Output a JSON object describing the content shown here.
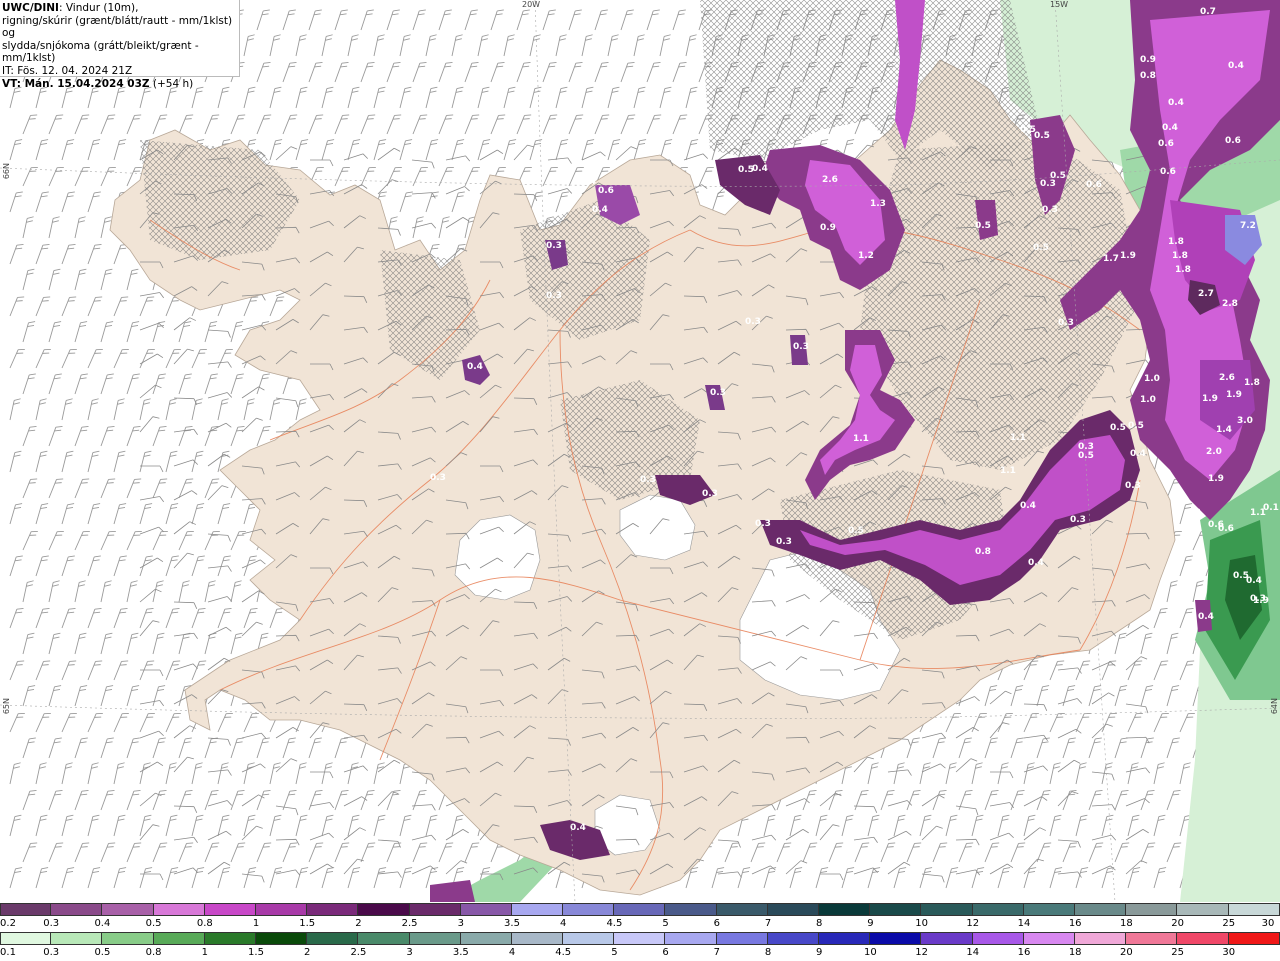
{
  "header": {
    "model": "UWC/DINI",
    "line1_rest": ": Vindur (10m),",
    "line2": "rigning/skúrir (grænt/blátt/rautt - mm/1klst) og",
    "line3": "slydda/snjókoma (grátt/bleikt/grænt - mm/1klst)",
    "line4": "IT: Fös. 12. 04. 2024 21Z",
    "line5_bold": "VT: Mán. 15.04.2024 03Z",
    "line5_rest": " (+54 h)"
  },
  "graticule_labels": {
    "lon_20w": "20W",
    "lon_15w": "15W",
    "lat_66n": "66N",
    "lat_65n": "65N",
    "lat_64n": "64N"
  },
  "map": {
    "region": "Iceland",
    "colors": {
      "sea": "#ffffff",
      "land": "#f1e4d6",
      "roads": "#e8835a",
      "barb": "#9a9a9a",
      "mix_purple_dark": "#5e2a5e",
      "mix_purple": "#8b3a8b",
      "mix_magenta": "#c050c8",
      "mix_pink": "#e070e0",
      "rain_green": "#3a9a50",
      "rain_green_light": "#9fd9a8",
      "rain_green_pale": "#d6f0d6",
      "blue_spot": "#8a8ae0"
    },
    "value_labels": [
      {
        "text": "0.7"
      },
      {
        "text": "0.4"
      },
      {
        "text": "0.9"
      },
      {
        "text": "0.8"
      },
      {
        "text": "0.4"
      },
      {
        "text": "0.4"
      },
      {
        "text": "0.5"
      },
      {
        "text": "0.6"
      },
      {
        "text": "0.6"
      },
      {
        "text": "0.6"
      },
      {
        "text": "7.2"
      },
      {
        "text": "1.8"
      },
      {
        "text": "1.8"
      },
      {
        "text": "1.8"
      },
      {
        "text": "2.7"
      },
      {
        "text": "2.8"
      },
      {
        "text": "1.7"
      },
      {
        "text": "1.9"
      },
      {
        "text": "2.6"
      },
      {
        "text": "1.9"
      },
      {
        "text": "1.9"
      },
      {
        "text": "1.8"
      },
      {
        "text": "3.0"
      },
      {
        "text": "1.4"
      },
      {
        "text": "2.0"
      },
      {
        "text": "1.9"
      },
      {
        "text": "1.0"
      },
      {
        "text": "1.0"
      },
      {
        "text": "0.5"
      },
      {
        "text": "0.5"
      },
      {
        "text": "1.9"
      },
      {
        "text": "0.6"
      },
      {
        "text": "2.6"
      },
      {
        "text": "1.3"
      },
      {
        "text": "0.9"
      },
      {
        "text": "1.2"
      },
      {
        "text": "0.5"
      },
      {
        "text": "0.4"
      },
      {
        "text": "0.3"
      },
      {
        "text": "0.5"
      },
      {
        "text": "0.3"
      },
      {
        "text": "0.5"
      },
      {
        "text": "0.5"
      },
      {
        "text": "0.3"
      },
      {
        "text": "0.6"
      },
      {
        "text": "0.4"
      },
      {
        "text": "1.1"
      },
      {
        "text": "1.1"
      },
      {
        "text": "1.1"
      },
      {
        "text": "0.3"
      },
      {
        "text": "0.3"
      },
      {
        "text": "0.3"
      },
      {
        "text": "0.5"
      },
      {
        "text": "0.8"
      },
      {
        "text": "0.4"
      },
      {
        "text": "0.3"
      },
      {
        "text": "0.5"
      },
      {
        "text": "0.3"
      },
      {
        "text": "0.3"
      },
      {
        "text": "0.3"
      },
      {
        "text": "0.4"
      },
      {
        "text": "0.4"
      },
      {
        "text": "0.4"
      },
      {
        "text": "0.3"
      },
      {
        "text": "0.4"
      },
      {
        "text": "0.6"
      },
      {
        "text": "0.4"
      },
      {
        "text": "0.3"
      },
      {
        "text": "0.4"
      },
      {
        "text": "0.3"
      },
      {
        "text": "0.3"
      },
      {
        "text": "0.3"
      },
      {
        "text": "0.3"
      },
      {
        "text": "0.3"
      },
      {
        "text": "0.5"
      },
      {
        "text": "1.1"
      },
      {
        "text": "0.4"
      },
      {
        "text": "0.3"
      },
      {
        "text": "0.6"
      },
      {
        "text": "0.1"
      },
      {
        "text": "0.5"
      },
      {
        "text": "0.3"
      }
    ]
  },
  "colorbar_snow": {
    "labels": [
      "0.2",
      "0.3",
      "0.4",
      "0.5",
      "0.8",
      "1",
      "1.5",
      "2",
      "2.5",
      "3",
      "3.5",
      "4",
      "4.5",
      "5",
      "6",
      "7",
      "8",
      "9",
      "10",
      "12",
      "14",
      "16",
      "18",
      "20",
      "25",
      "30"
    ],
    "colors": [
      "#6a3a6a",
      "#8a4a8a",
      "#a860a8",
      "#d878d8",
      "#c848c8",
      "#a83aa8",
      "#7a2a7a",
      "#4a0a4a",
      "#6a2a6a",
      "#8858a8",
      "#a8a8f0",
      "#8888d8",
      "#6868b8",
      "#4a5a8a",
      "#3a5a6a",
      "#2a4a5a",
      "#0a3a3a",
      "#1a4a4a",
      "#2a5a5a",
      "#3a6a6a",
      "#4a7a7a",
      "#6a8a8a",
      "#8a9a9a",
      "#a8b8b8",
      "#c8d8d8"
    ]
  },
  "colorbar_rain": {
    "labels": [
      "0.1",
      "0.3",
      "0.5",
      "0.8",
      "1",
      "1.5",
      "2",
      "2.5",
      "3",
      "3.5",
      "4",
      "4.5",
      "5",
      "6",
      "7",
      "8",
      "9",
      "10",
      "12",
      "14",
      "16",
      "18",
      "20",
      "25",
      "30"
    ],
    "colors": [
      "#e0f8e0",
      "#b8e8b8",
      "#88cc88",
      "#58aa58",
      "#2a7a2a",
      "#0a4a0a",
      "#2a6a4a",
      "#4a8a6a",
      "#6a9a8a",
      "#8aaaaa",
      "#a8b8c8",
      "#b8c8e8",
      "#c8c8f8",
      "#a8a8f0",
      "#7878e0",
      "#4848c8",
      "#2828b8",
      "#0a0aa8",
      "#6a3ac8",
      "#a858e8",
      "#d888f0",
      "#f0a8d8",
      "#f07898",
      "#f04868",
      "#f01818"
    ]
  }
}
